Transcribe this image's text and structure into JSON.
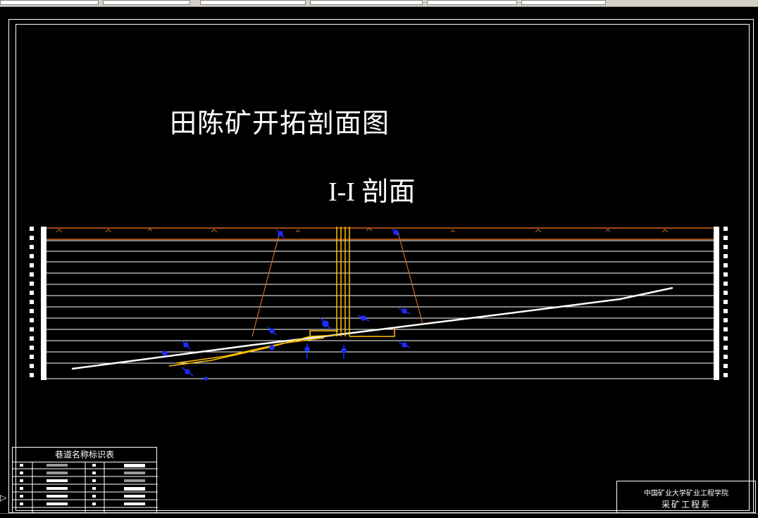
{
  "drawing": {
    "title": "田陈矿开拓剖面图",
    "subtitle": "I-I 剖面"
  },
  "legend": {
    "title": "巷道名称标识表"
  },
  "titleblock": {
    "line1": "中国矿业大学矿业工程学院",
    "line2": "采矿工程系"
  },
  "colors": {
    "background": "#000000",
    "lines": "#ffffff",
    "surface": "#d2691e",
    "shaft": "#ffc000",
    "symbols": "#1e2cff"
  }
}
